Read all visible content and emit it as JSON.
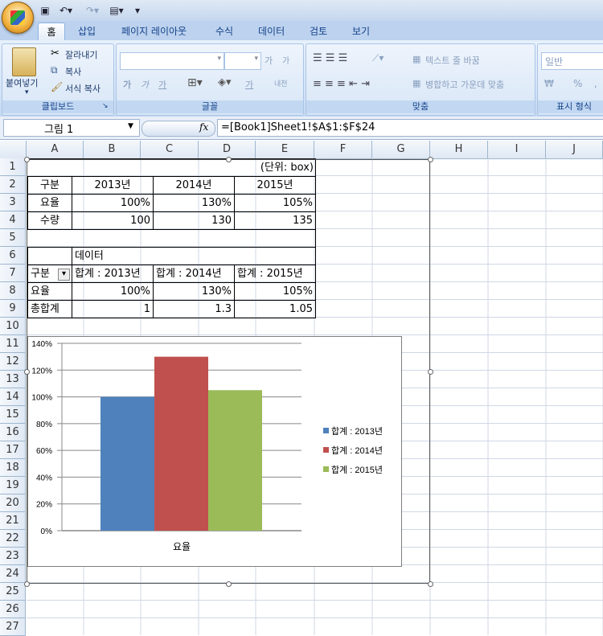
{
  "quick_access": {
    "undo_icon": "undo-icon",
    "redo_icon": "redo-icon",
    "customize": "▾"
  },
  "ribbon_tabs": [
    "홈",
    "삽입",
    "페이지 레이아웃",
    "수식",
    "데이터",
    "검토",
    "보기"
  ],
  "clipboard": {
    "paste": "붙여넣기",
    "cut": "잘라내기",
    "copy": "복사",
    "format_painter": "서식 복사",
    "label": "클립보드"
  },
  "font": {
    "grow": "가",
    "shrink": "가",
    "bold": "가",
    "italic": "가",
    "underline": "가",
    "font_color": "가",
    "phonetic": "내천",
    "label": "글꼴"
  },
  "alignment": {
    "wrap": "텍스트 줄 바꿈",
    "merge": "병합하고 가운데 맞춤",
    "label": "맞춤"
  },
  "number": {
    "format": "일반",
    "currency": "₩",
    "percent": "%",
    "comma": ",",
    "label": "표시 형식"
  },
  "formula_bar": {
    "name_box": "그림 1",
    "fx": "fx",
    "formula": "=[Book1]Sheet1!$A$1:$F$24"
  },
  "columns": [
    "A",
    "B",
    "C",
    "D",
    "E",
    "F",
    "G",
    "H",
    "I",
    "J"
  ],
  "rows": [
    "1",
    "2",
    "3",
    "4",
    "5",
    "6",
    "7",
    "8",
    "9",
    "10",
    "11",
    "12",
    "13",
    "14",
    "15",
    "16",
    "17",
    "18",
    "19",
    "20",
    "21",
    "22",
    "23",
    "24",
    "25",
    "26",
    "27"
  ],
  "sheet": {
    "unit": "(단위: box)",
    "table1_header": [
      "구분",
      "2013년",
      "2014년",
      "2015년"
    ],
    "table1_rows": [
      [
        "요율",
        "100%",
        "130%",
        "105%"
      ],
      [
        "수량",
        "100",
        "130",
        "135"
      ]
    ],
    "pivot_data_label": "데이터",
    "pivot_header": [
      "구분",
      "합계 : 2013년",
      "합계 : 2014년",
      "합계 : 2015년"
    ],
    "pivot_rows": [
      [
        "요율",
        "100%",
        "130%",
        "105%"
      ],
      [
        "총합계",
        "1",
        "1.3",
        "1.05"
      ]
    ]
  },
  "chart_data": {
    "type": "bar",
    "categories": [
      "요율"
    ],
    "series": [
      {
        "name": "합계 : 2013년",
        "values": [
          100
        ],
        "color": "#4f81bd"
      },
      {
        "name": "합계 : 2014년",
        "values": [
          130
        ],
        "color": "#c0504d"
      },
      {
        "name": "합계 : 2015년",
        "values": [
          105
        ],
        "color": "#9bbb59"
      }
    ],
    "ylim": [
      0,
      140
    ],
    "yticks": [
      "0%",
      "20%",
      "40%",
      "60%",
      "80%",
      "100%",
      "120%",
      "140%"
    ],
    "grid": true,
    "legend": "right"
  }
}
